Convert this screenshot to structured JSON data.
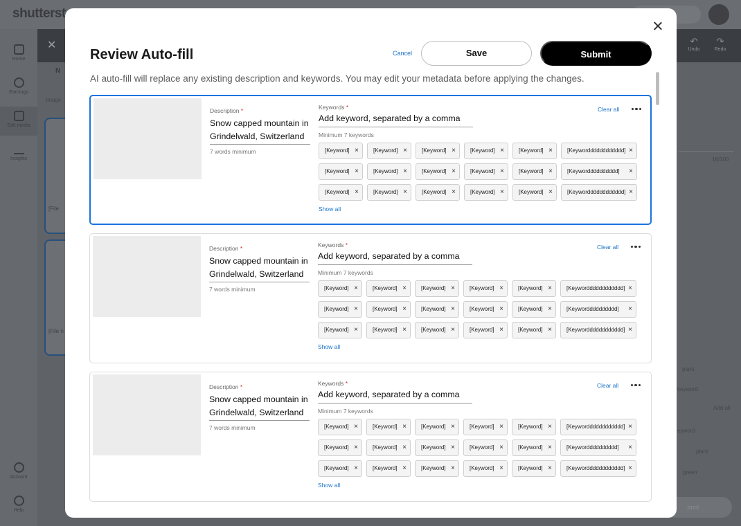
{
  "background": {
    "logo": "shutterst",
    "rail": [
      {
        "label": "Home",
        "icon": "home-icon"
      },
      {
        "label": "Earnings",
        "icon": "dollar-icon"
      },
      {
        "label": "Edit media",
        "icon": "edit-media-icon"
      },
      {
        "label": "Insights",
        "icon": "insights-icon"
      },
      {
        "label": "Account",
        "icon": "account-icon"
      },
      {
        "label": "Help",
        "icon": "help-icon"
      }
    ],
    "undo_label": "Undo",
    "redo_label": "Redo",
    "tab_label": "N",
    "images_label": "Image",
    "file_label_1": "[File",
    "file_label_2": "[File n",
    "counter": "18/100",
    "kw_plant": "plant",
    "kw_keyword": "keyword",
    "add_all": "Add all",
    "kw_keyword2": "eyword",
    "kw_plant2": "plant",
    "kw_green": "green",
    "submit": "bmit"
  },
  "modal": {
    "title": "Review Auto-fill",
    "cancel_label": "Cancel",
    "save_label": "Save",
    "submit_label": "Submit",
    "subtitle": "AI auto-fill will replace any existing description and keywords. You may edit your metadata before applying the changes.",
    "items": [
      {
        "description_label": "Description",
        "description": "Snow capped mountain in Grindelwald, Switzerland",
        "description_help": "7 words minimum",
        "keywords_label": "Keywords",
        "keyword_placeholder": "Add keyword, separated by a comma",
        "keywords_help": "Minimum 7 keywords",
        "clear_all": "Clear all",
        "show_all": "Show all",
        "chip_rows": [
          [
            "[Keyword]",
            "[Keyword]",
            "[Keyword]",
            "[Keyword]",
            "[Keyword]",
            "[Keywordddddddddddd]"
          ],
          [
            "[Keyword]",
            "[Keyword]",
            "[Keyword]",
            "[Keyword]",
            "[Keyword]",
            "[Keywordddddddddd]"
          ],
          [
            "[Keyword]",
            "[Keyword]",
            "[Keyword]",
            "[Keyword]",
            "[Keyword]",
            "[Keywordddddddddddd]"
          ]
        ]
      },
      {
        "description_label": "Description",
        "description": "Snow capped mountain in Grindelwald, Switzerland",
        "description_help": "7 words minimum",
        "keywords_label": "Keywords",
        "keyword_placeholder": "Add keyword, separated by a comma",
        "keywords_help": "Minimum 7 keywords",
        "clear_all": "Clear all",
        "show_all": "Show all",
        "chip_rows": [
          [
            "[Keyword]",
            "[Keyword]",
            "[Keyword]",
            "[Keyword]",
            "[Keyword]",
            "[Keywordddddddddddd]"
          ],
          [
            "[Keyword]",
            "[Keyword]",
            "[Keyword]",
            "[Keyword]",
            "[Keyword]",
            "[Keywordddddddddd]"
          ],
          [
            "[Keyword]",
            "[Keyword]",
            "[Keyword]",
            "[Keyword]",
            "[Keyword]",
            "[Keywordddddddddddd]"
          ]
        ]
      },
      {
        "description_label": "Description",
        "description": "Snow capped mountain in Grindelwald, Switzerland",
        "description_help": "7 words minimum",
        "keywords_label": "Keywords",
        "keyword_placeholder": "Add keyword, separated by a comma",
        "keywords_help": "Minimum 7 keywords",
        "clear_all": "Clear all",
        "show_all": "Show all",
        "chip_rows": [
          [
            "[Keyword]",
            "[Keyword]",
            "[Keyword]",
            "[Keyword]",
            "[Keyword]",
            "[Keywordddddddddddd]"
          ],
          [
            "[Keyword]",
            "[Keyword]",
            "[Keyword]",
            "[Keyword]",
            "[Keyword]",
            "[Keywordddddddddd]"
          ],
          [
            "[Keyword]",
            "[Keyword]",
            "[Keyword]",
            "[Keyword]",
            "[Keyword]",
            "[Keywordddddddddddd]"
          ]
        ]
      }
    ]
  },
  "colors": {
    "accent": "#1a73e0",
    "link": "#1a73c8",
    "required": "#d32f2f",
    "overlay": "#5f6266"
  }
}
